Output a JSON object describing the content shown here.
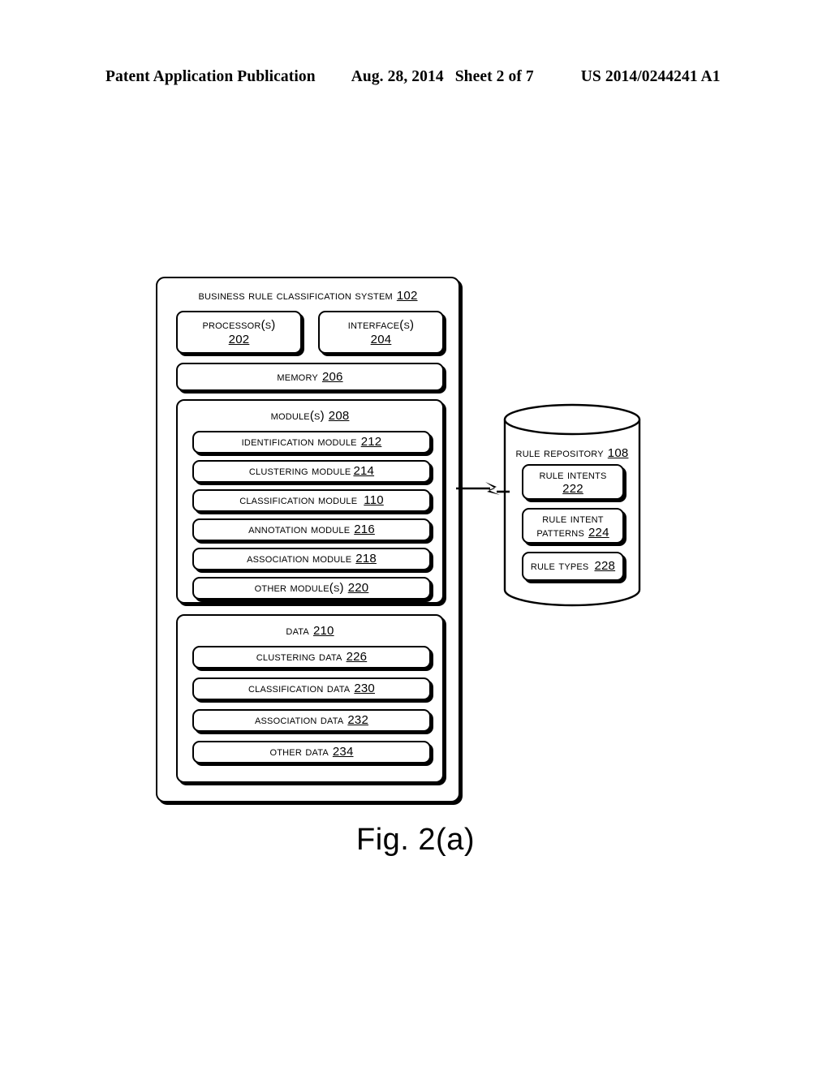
{
  "header": {
    "publication": "Patent Application Publication",
    "date": "Aug. 28, 2014",
    "sheet": "Sheet 2 of 7",
    "document_number": "US 2014/0244241 A1"
  },
  "figure": {
    "caption": "Fig. 2(a)",
    "system": {
      "title": "Business Rule Classification System",
      "ref": "102",
      "processor": {
        "label": "Processor(s)",
        "ref": "202"
      },
      "interface": {
        "label": "Interface(s)",
        "ref": "204"
      },
      "memory": {
        "label": "Memory",
        "ref": "206"
      },
      "modules": {
        "title": "Module(s)",
        "ref": "208",
        "items": [
          {
            "label": "Identification Module",
            "ref": "212"
          },
          {
            "label": "Clustering Module",
            "ref": "214"
          },
          {
            "label": "Classification Module",
            "ref": "110"
          },
          {
            "label": "Annotation Module",
            "ref": "216"
          },
          {
            "label": "Association Module",
            "ref": "218"
          },
          {
            "label": "Other Module(s)",
            "ref": "220"
          }
        ]
      },
      "data": {
        "title": "Data",
        "ref": "210",
        "items": [
          {
            "label": "Clustering Data",
            "ref": "226"
          },
          {
            "label": "Classification Data",
            "ref": "230"
          },
          {
            "label": "Association Data",
            "ref": "232"
          },
          {
            "label": "Other Data",
            "ref": "234"
          }
        ]
      }
    },
    "repository": {
      "title": "Rule Repository",
      "ref": "108",
      "items": [
        {
          "label": "Rule Intents",
          "ref": "222",
          "two_line": true
        },
        {
          "label": "Rule Intent Patterns",
          "ref": "224",
          "two_line": true
        },
        {
          "label": "Rule Types",
          "ref": "228",
          "two_line": false
        }
      ]
    },
    "connector": {
      "name": "network-link-connector"
    }
  },
  "colors": {
    "ink": "#000000",
    "paper": "#ffffff"
  }
}
